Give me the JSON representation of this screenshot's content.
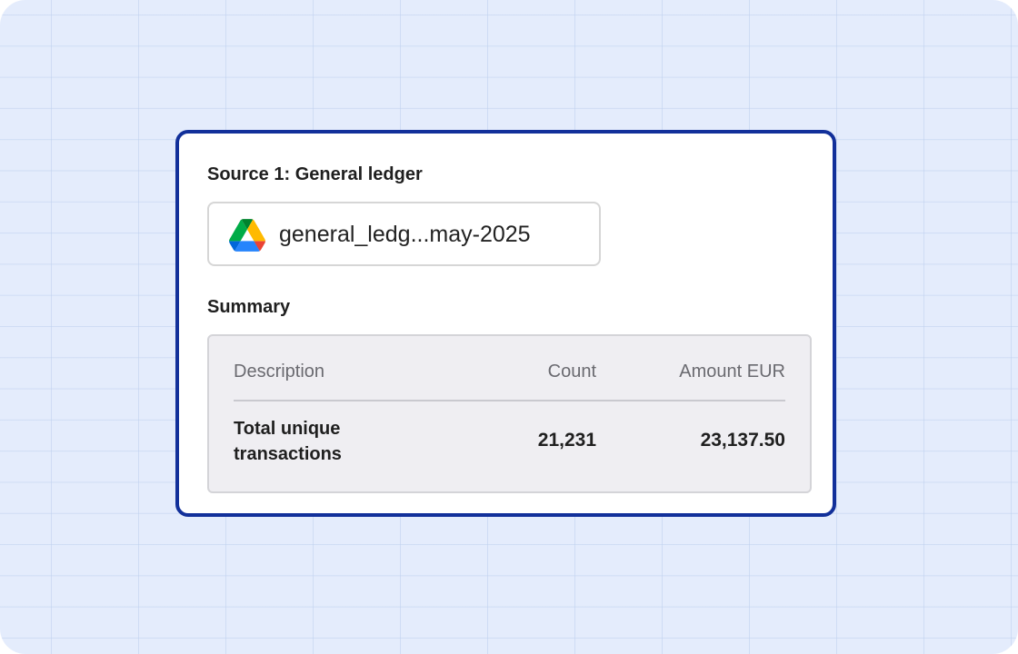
{
  "source": {
    "title": "Source 1:  General ledger",
    "file": {
      "name": "general_ledg...may-2025",
      "icon": "google-drive-icon"
    }
  },
  "summary": {
    "title": "Summary",
    "columns": [
      "Description",
      "Count",
      "Amount EUR"
    ],
    "rows": [
      {
        "description": "Total unique transactions",
        "count": "21,231",
        "amount": "23,137.50"
      }
    ]
  },
  "colors": {
    "background": "#e4ecfc",
    "card_border": "#12309a",
    "summary_fill": "#efeef2"
  }
}
